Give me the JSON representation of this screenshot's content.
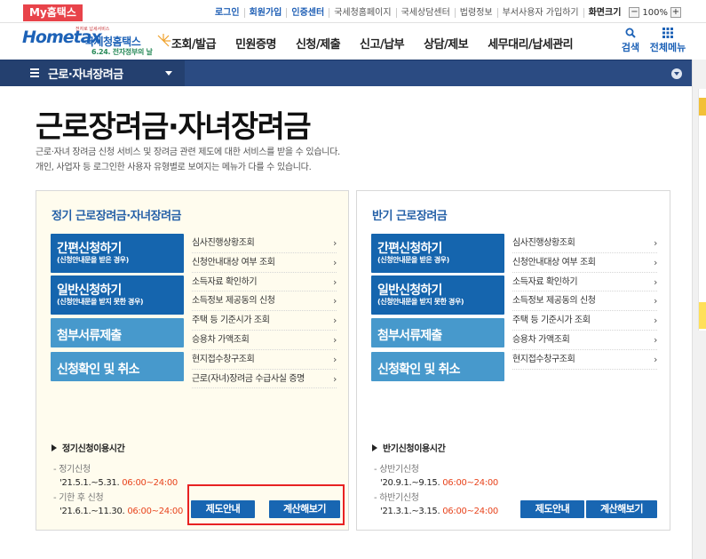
{
  "topbar": {
    "my_hometax": "My홈택스",
    "links": [
      {
        "label": "로그인",
        "style": "blue"
      },
      {
        "label": "회원가입",
        "style": "blue"
      },
      {
        "label": "인증센터",
        "style": "blue"
      },
      {
        "label": "국세청홈페이지",
        "style": "plain"
      },
      {
        "label": "국세상담센터",
        "style": "plain"
      },
      {
        "label": "법령정보",
        "style": "plain"
      },
      {
        "label": "부서사용자 가입하기",
        "style": "plain"
      },
      {
        "label": "화면크기",
        "style": "dark"
      }
    ],
    "zoom": {
      "minus": "−",
      "value": "100%",
      "plus": "+"
    }
  },
  "header": {
    "logo": {
      "brand": "Hometax",
      "tagline": "전자로 납세서비스",
      "title": "국세청홈택스",
      "event": "6.24. 전자정부의 날"
    },
    "gnb": [
      "조회/발급",
      "민원증명",
      "신청/제출",
      "신고/납부",
      "상담/제보",
      "세무대리/납세관리"
    ],
    "search_label": "검색",
    "allmenu_label": "전체메뉴"
  },
  "location": {
    "menu_label": "근로·자녀장려금"
  },
  "page": {
    "title": "근로장려금·자녀장려금",
    "desc_line1": "근로·자녀 장려금 신청 서비스 및 장려금 관련 제도에 대한 서비스를 받을 수 있습니다.",
    "desc_line2": "개인, 사업자 등 로그인한 사용자 유형별로 보여지는 메뉴가 다를 수 있습니다."
  },
  "regular": {
    "title": "정기 근로장려금·자녀장려금",
    "actions": {
      "simple_main": "간편신청하기",
      "simple_sub": "(신청안내문을 받은 경우)",
      "general_main": "일반신청하기",
      "general_sub": "(신청안내문을 받지 못한 경우)",
      "attach": "첨부서류제출",
      "confirm": "신청확인 및 취소"
    },
    "links": [
      "심사진행상황조회",
      "신청안내대상 여부 조회",
      "소득자료 확인하기",
      "소득정보 제공동의 신청",
      "주택 등 기준시가 조회",
      "승용차 가액조회",
      "현지접수창구조회",
      "근로(자녀)장려금 수급사실 증명"
    ],
    "hours_title": "정기신청이용시간",
    "period1_label": "정기신청",
    "period1_date": "'21.5.1.~5.31.",
    "period1_time": "06:00~24:00",
    "period2_label": "기한 후 신청",
    "period2_date": "'21.6.1.~11.30.",
    "period2_time": "06:00~24:00",
    "btn_guide": "제도안내",
    "btn_calc": "계산해보기"
  },
  "half": {
    "title": "반기 근로장려금",
    "actions": {
      "simple_main": "간편신청하기",
      "simple_sub": "(신청안내문을 받은 경우)",
      "general_main": "일반신청하기",
      "general_sub": "(신청안내문을 받지 못한 경우)",
      "attach": "첨부서류제출",
      "confirm": "신청확인 및 취소"
    },
    "links": [
      "심사진행상황조회",
      "신청안내대상 여부 조회",
      "소득자료 확인하기",
      "소득정보 제공동의 신청",
      "주택 등 기준시가 조회",
      "승용차 가액조회",
      "현지접수창구조회"
    ],
    "hours_title": "반기신청이용시간",
    "period1_label": "상반기신청",
    "period1_date": "'20.9.1.~9.15.",
    "period1_time": "06:00~24:00",
    "period2_label": "하반기신청",
    "period2_date": "'21.3.1.~3.15.",
    "period2_time": "06:00~24:00",
    "btn_guide": "제도안내",
    "btn_calc": "계산해보기"
  },
  "colors": {
    "brand_blue": "#1d62b7",
    "action_dark": "#1565ae",
    "action_light": "#4799cc",
    "location_bar": "#2b4b82",
    "highlight_red": "#e82222",
    "time_orange": "#e8441d",
    "panel_cream": "#fffcee"
  },
  "icons": {
    "search": "search-icon",
    "allmenu": "grid-icon",
    "menu": "hamburger-icon",
    "link_arrow": "chevron-right-icon"
  }
}
